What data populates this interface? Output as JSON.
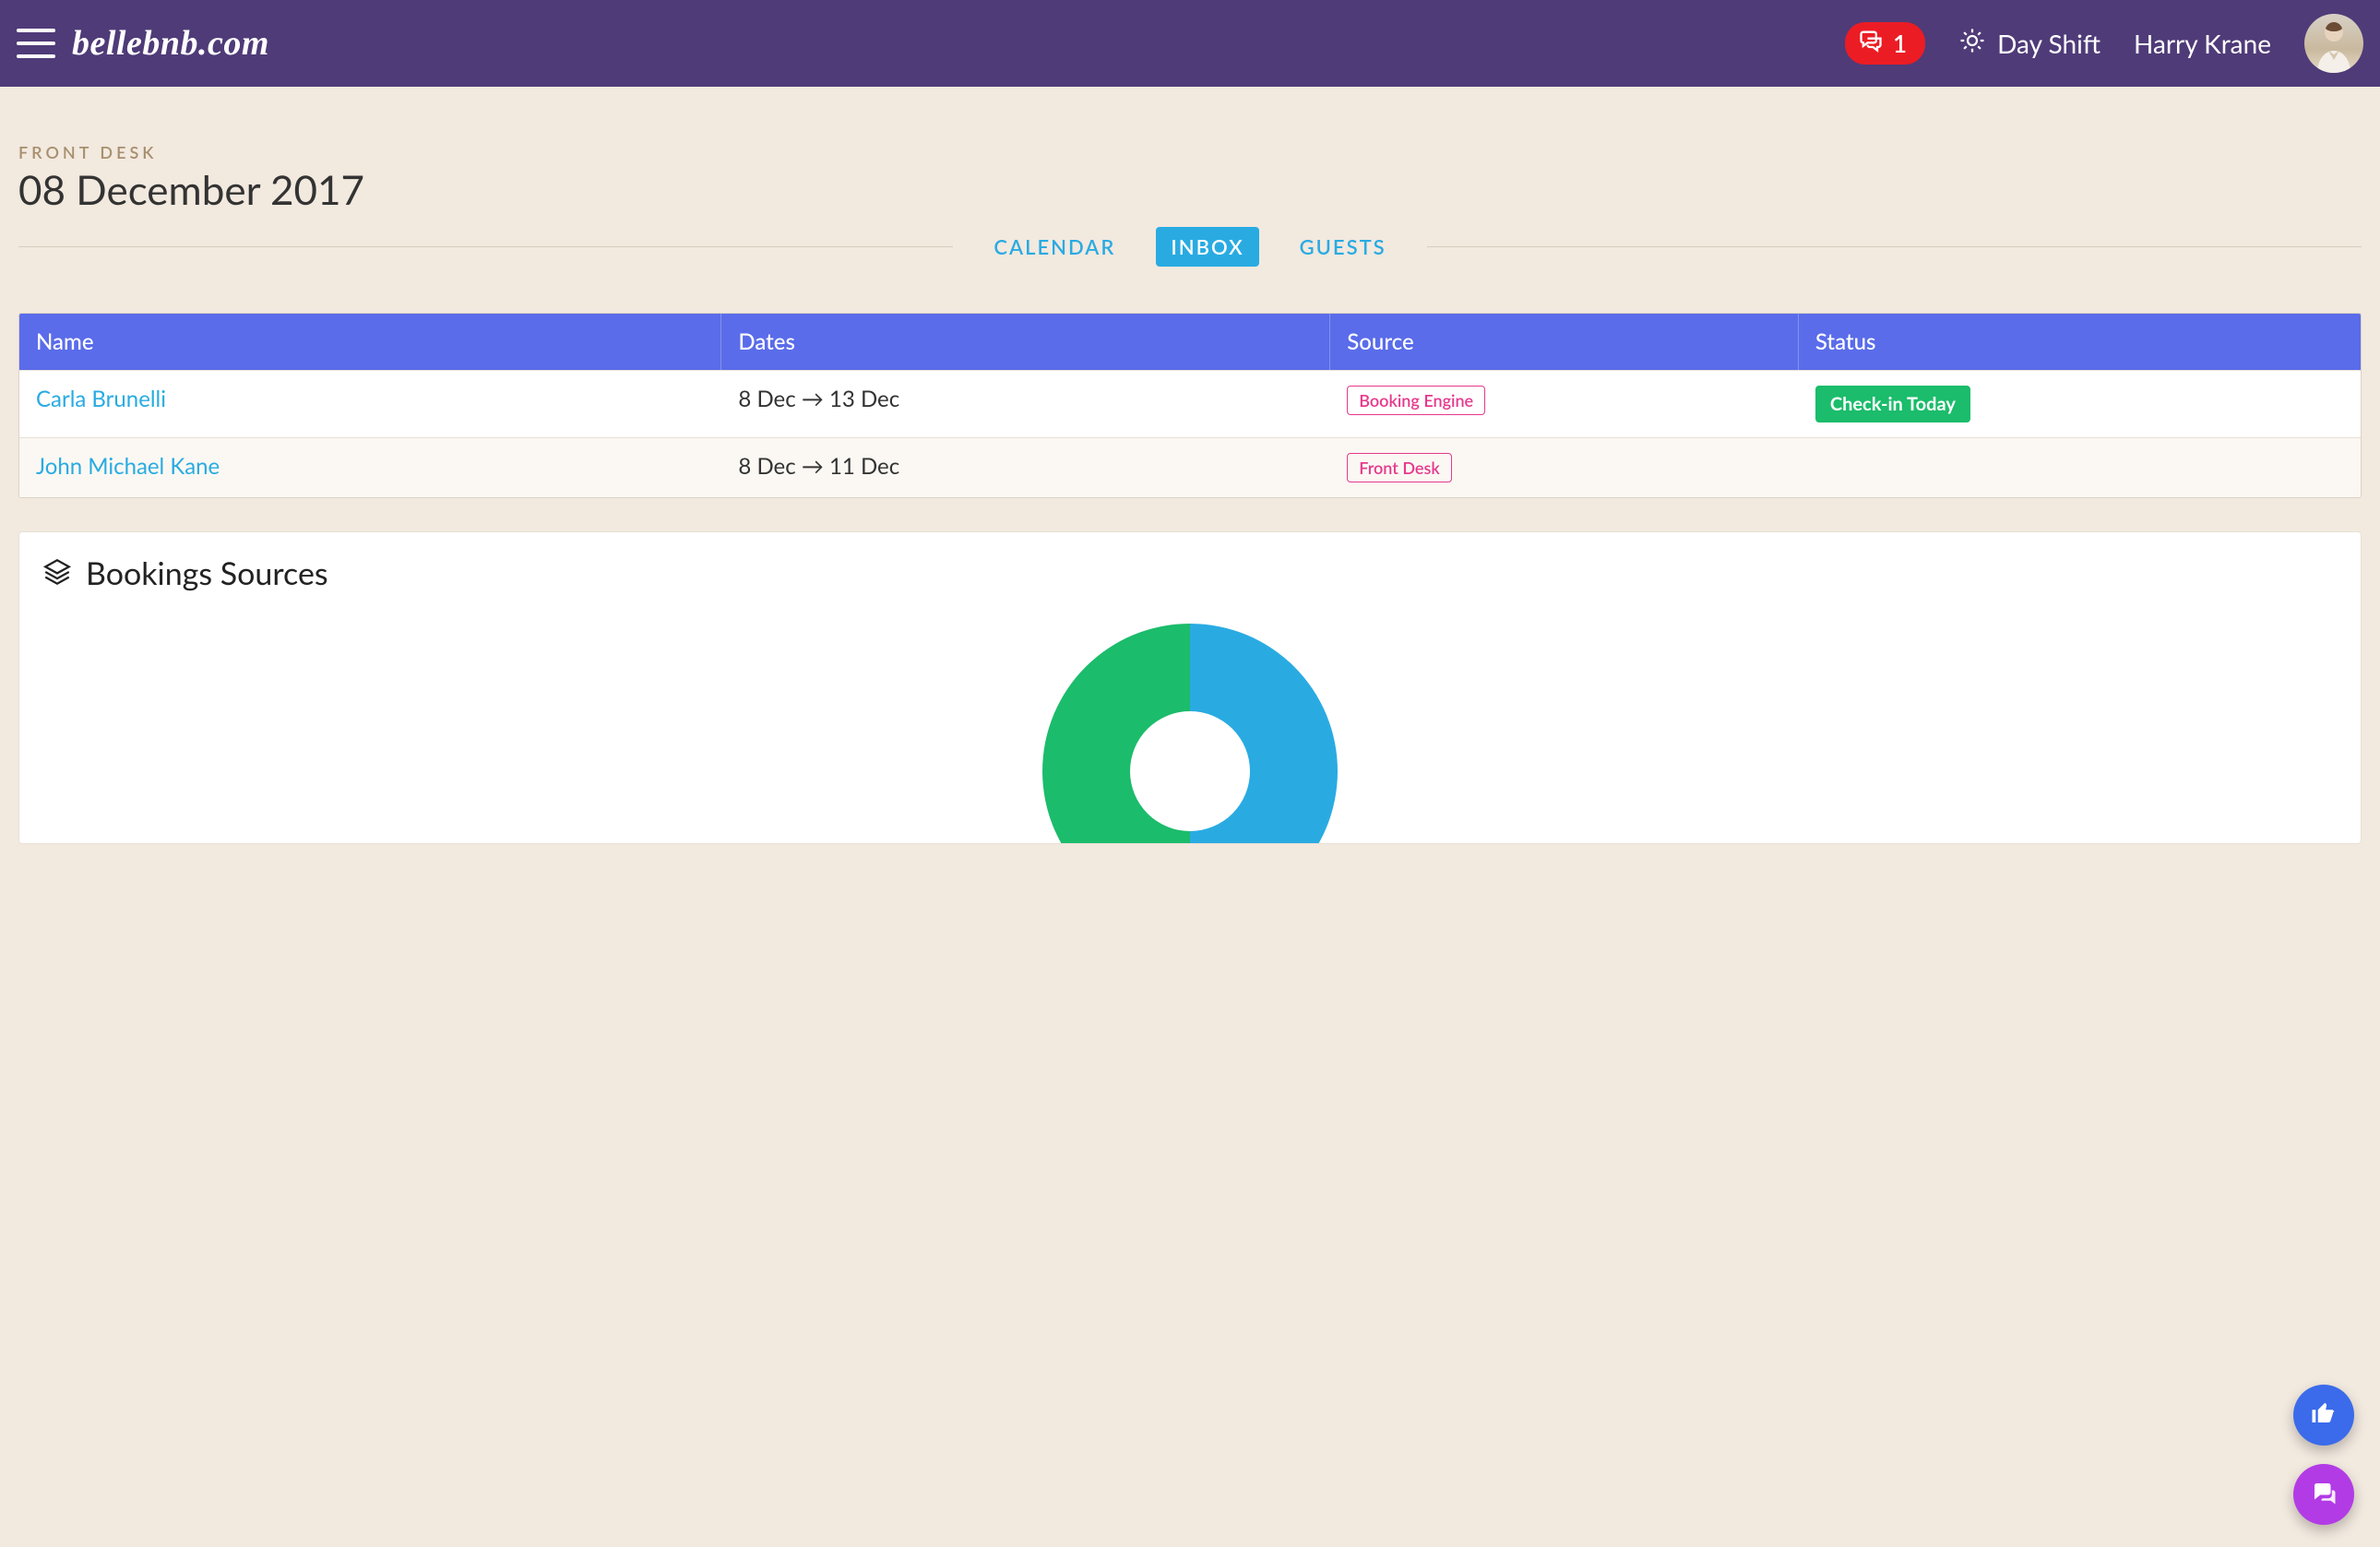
{
  "header": {
    "app_name": "bellebnb.com",
    "notif_count": "1",
    "shift_label": "Day Shift",
    "user_name": "Harry Krane"
  },
  "page": {
    "crumb": "FRONT DESK",
    "title": "08 December 2017"
  },
  "tabs": {
    "calendar": "CALENDAR",
    "inbox": "INBOX",
    "guests": "GUESTS",
    "active": "inbox"
  },
  "table": {
    "headers": {
      "name": "Name",
      "dates": "Dates",
      "source": "Source",
      "status": "Status"
    },
    "rows": [
      {
        "name": "Carla Brunelli",
        "dates": "8 Dec → 13 Dec",
        "source": "Booking Engine",
        "status": "Check-in Today"
      },
      {
        "name": "John Michael Kane",
        "dates": "8 Dec → 11 Dec",
        "source": "Front Desk",
        "status": ""
      }
    ]
  },
  "card": {
    "title": "Bookings Sources"
  },
  "chart_data": {
    "type": "pie",
    "title": "Bookings Sources",
    "series": [
      {
        "name": "Booking Engine",
        "value": 50,
        "color": "#29abe2"
      },
      {
        "name": "Front Desk",
        "value": 50,
        "color": "#1bbc6b"
      }
    ]
  },
  "colors": {
    "brand_purple": "#4f3b78",
    "accent_blue": "#29abe2",
    "table_header": "#5a6cea",
    "badge_pink": "#e6398c",
    "status_green": "#1bbc6b",
    "notif_red": "#ec1c24"
  }
}
